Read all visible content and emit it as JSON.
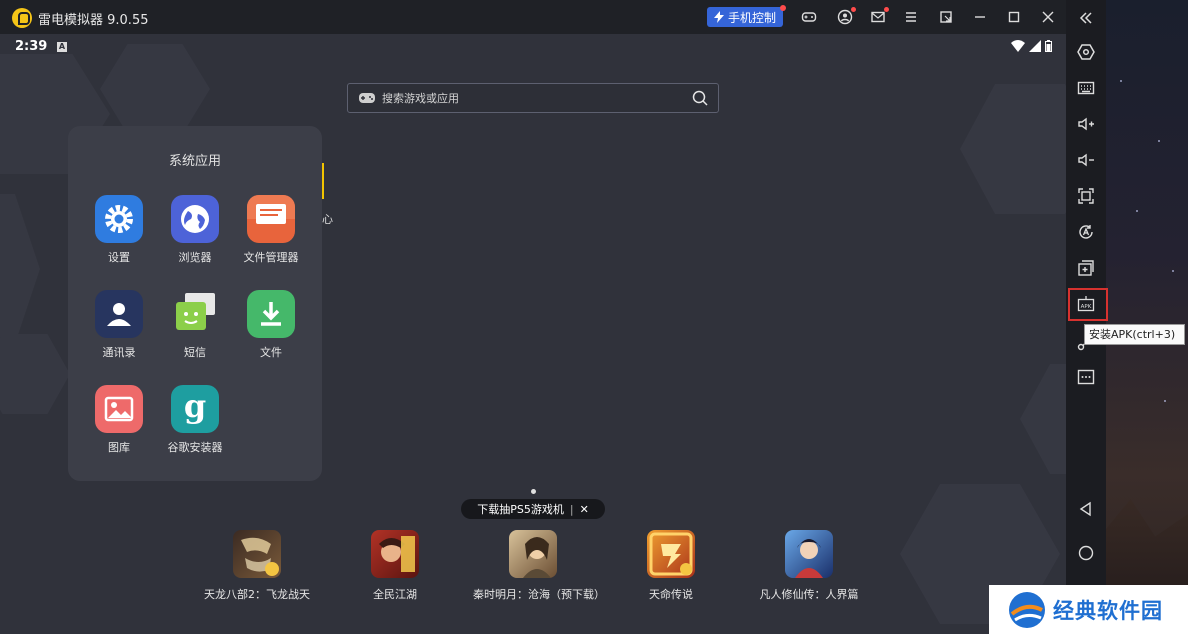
{
  "window": {
    "title": "雷电模拟器 9.0.55",
    "phone_control_label": "手机控制"
  },
  "android_status": {
    "time": "2:39",
    "notif_letter": "A"
  },
  "search": {
    "placeholder": "搜索游戏或应用"
  },
  "folder": {
    "title": "系统应用",
    "apps": [
      {
        "label": "设置",
        "icon": "settings-icon",
        "color": "#2f7ce0"
      },
      {
        "label": "浏览器",
        "icon": "browser-icon",
        "color": "#4d63d8"
      },
      {
        "label": "文件管理器",
        "icon": "file-manager-icon",
        "color": "#e8643c"
      },
      {
        "label": "通讯录",
        "icon": "contacts-icon",
        "color": "#27355f"
      },
      {
        "label": "短信",
        "icon": "sms-icon",
        "color": "#8ccf4a"
      },
      {
        "label": "文件",
        "icon": "download-file-icon",
        "color": "#45b86a"
      },
      {
        "label": "图库",
        "icon": "gallery-icon",
        "color": "#ee6a6a"
      },
      {
        "label": "谷歌安装器",
        "icon": "google-installer-icon",
        "color": "#1e9ea0"
      }
    ]
  },
  "partial_label": "心",
  "promo": {
    "text": "下载抽PS5游戏机",
    "close": "✕"
  },
  "games": [
    {
      "label": "天龙八部2：飞龙战天",
      "color": "#5a3b2a"
    },
    {
      "label": "全民江湖",
      "color": "#b23226"
    },
    {
      "label": "秦时明月：沧海（预下载）",
      "color": "#8a6a45"
    },
    {
      "label": "天命传说",
      "color": "#c4451d"
    },
    {
      "label": "凡人修仙传：人界篇",
      "color": "#2b4f8f"
    }
  ],
  "sidebar": {
    "tooltip": "安装APK(ctrl+3)"
  },
  "watermark": {
    "text": "经典软件园"
  }
}
